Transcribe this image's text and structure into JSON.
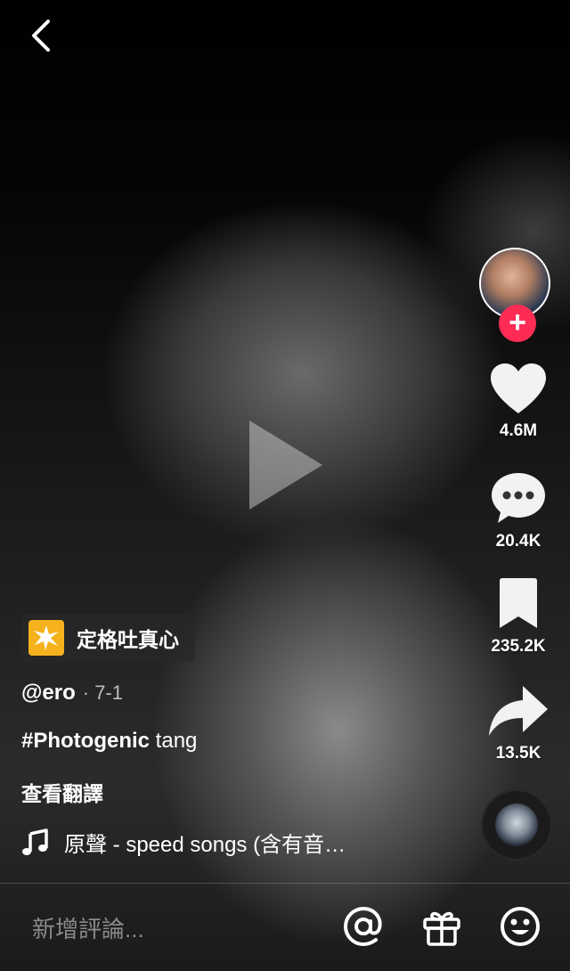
{
  "video": {
    "play_icon": "play-icon"
  },
  "nav": {
    "back_icon": "chevron-left-icon"
  },
  "author": {
    "handle": "@ero",
    "date": "· 7-1"
  },
  "actions": {
    "like_count": "4.6M",
    "comment_count": "20.4K",
    "favorite_count": "235.2K",
    "share_count": "13.5K",
    "follow_symbol": "+"
  },
  "effect": {
    "label": "定格吐真心",
    "icon": "burst-icon"
  },
  "caption": {
    "hashtag": "#Photogenic",
    "text": " tang"
  },
  "translate": {
    "label": "查看翻譯"
  },
  "music": {
    "text": "原聲 - speed songs (含有音…",
    "icon": "music-note-icon"
  },
  "comment": {
    "placeholder": "新增評論..."
  },
  "colors": {
    "accent": "#fe2c55",
    "effect_bg": "#f6b21c"
  }
}
